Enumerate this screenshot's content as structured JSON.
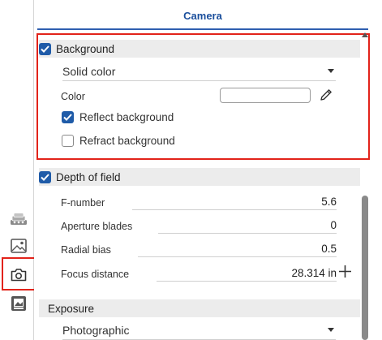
{
  "panel": {
    "title": "Camera"
  },
  "rail": {
    "icons": [
      "layers-icon",
      "image-icon",
      "camera-icon",
      "render-icon"
    ],
    "selected": "camera-icon"
  },
  "background": {
    "label": "Background",
    "checked": true,
    "type_value": "Solid color",
    "color_label": "Color",
    "color_value": "#ffffff",
    "reflect_label": "Reflect background",
    "reflect_checked": true,
    "refract_label": "Refract background",
    "refract_checked": false
  },
  "depth_of_field": {
    "label": "Depth of field",
    "checked": true,
    "fields": [
      {
        "label": "F-number",
        "value": "5.6"
      },
      {
        "label": "Aperture blades",
        "value": "0"
      },
      {
        "label": "Radial bias",
        "value": "0.5"
      },
      {
        "label": "Focus distance",
        "value": "28.314 in"
      }
    ]
  },
  "exposure": {
    "label": "Exposure",
    "mode_value": "Photographic"
  },
  "colors": {
    "accent": "#1f5ba8",
    "highlight": "#e2231a",
    "title": "#1b4f9c"
  }
}
